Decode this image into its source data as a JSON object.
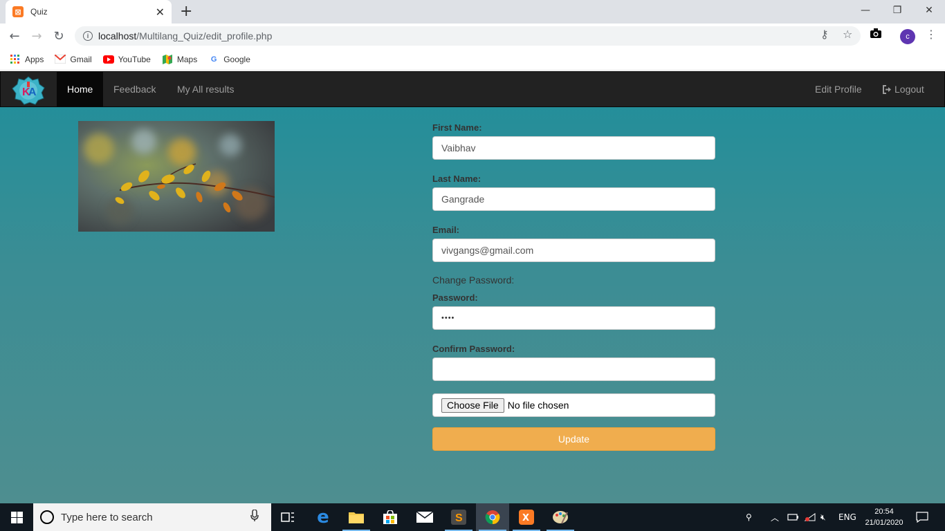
{
  "browser": {
    "tab_title": "Quiz",
    "url_host": "localhost",
    "url_path": "/Multilang_Quiz/edit_profile.php",
    "profile_initial": "c",
    "bookmarks": [
      {
        "label": "Apps",
        "icon": "apps-grid-icon"
      },
      {
        "label": "Gmail",
        "icon": "gmail-icon"
      },
      {
        "label": "YouTube",
        "icon": "youtube-icon"
      },
      {
        "label": "Maps",
        "icon": "maps-icon"
      },
      {
        "label": "Google",
        "icon": "google-icon"
      }
    ]
  },
  "navbar": {
    "links": [
      "Home",
      "Feedback",
      "My All results"
    ],
    "active": "Home",
    "edit_profile": "Edit Profile",
    "logout": "Logout"
  },
  "form": {
    "first_name_label": "First Name:",
    "first_name_value": "Vaibhav",
    "last_name_label": "Last Name:",
    "last_name_value": "Gangrade",
    "email_label": "Email:",
    "email_value": "vivgangs@gmail.com",
    "change_password_text": "Change Password:",
    "password_label": "Password:",
    "password_value": "••••",
    "confirm_password_label": "Confirm Password:",
    "confirm_password_value": "",
    "choose_file_label": "Choose File",
    "no_file_text": "No file chosen",
    "update_label": "Update"
  },
  "taskbar": {
    "search_placeholder": "Type here to search",
    "language": "ENG",
    "time": "20:54",
    "date": "21/01/2020"
  },
  "colors": {
    "navbar_bg": "#222222",
    "page_bg_top": "#1f8f9b",
    "page_bg_bottom": "#4e8e90",
    "update_button": "#f0ad4e"
  }
}
